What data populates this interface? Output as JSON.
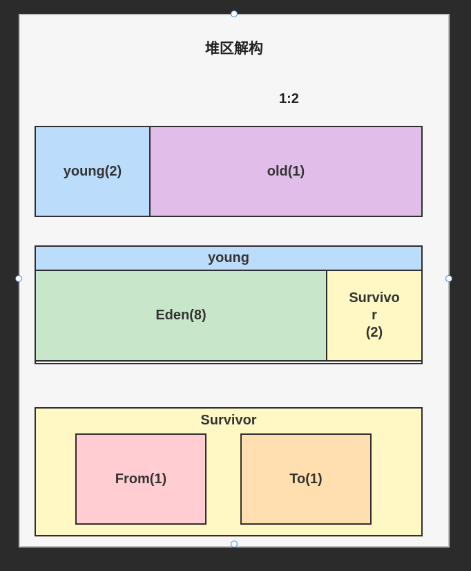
{
  "diagram": {
    "title": "堆区解构",
    "ratio": "1:2",
    "row1": {
      "young": "young(2)",
      "old": "old(1)"
    },
    "row2": {
      "header": "young",
      "eden": "Eden(8)",
      "survivor": "Survivo\nr\n(2)"
    },
    "row3": {
      "header": "Survivor",
      "from": "From(1)",
      "to": "To(1)"
    }
  },
  "colors": {
    "young": "#bcdcfb",
    "old": "#e1bee9",
    "eden": "#c8e6c9",
    "survivor": "#fff8c4",
    "from": "#ffcdd2",
    "to": "#ffdeb0"
  }
}
